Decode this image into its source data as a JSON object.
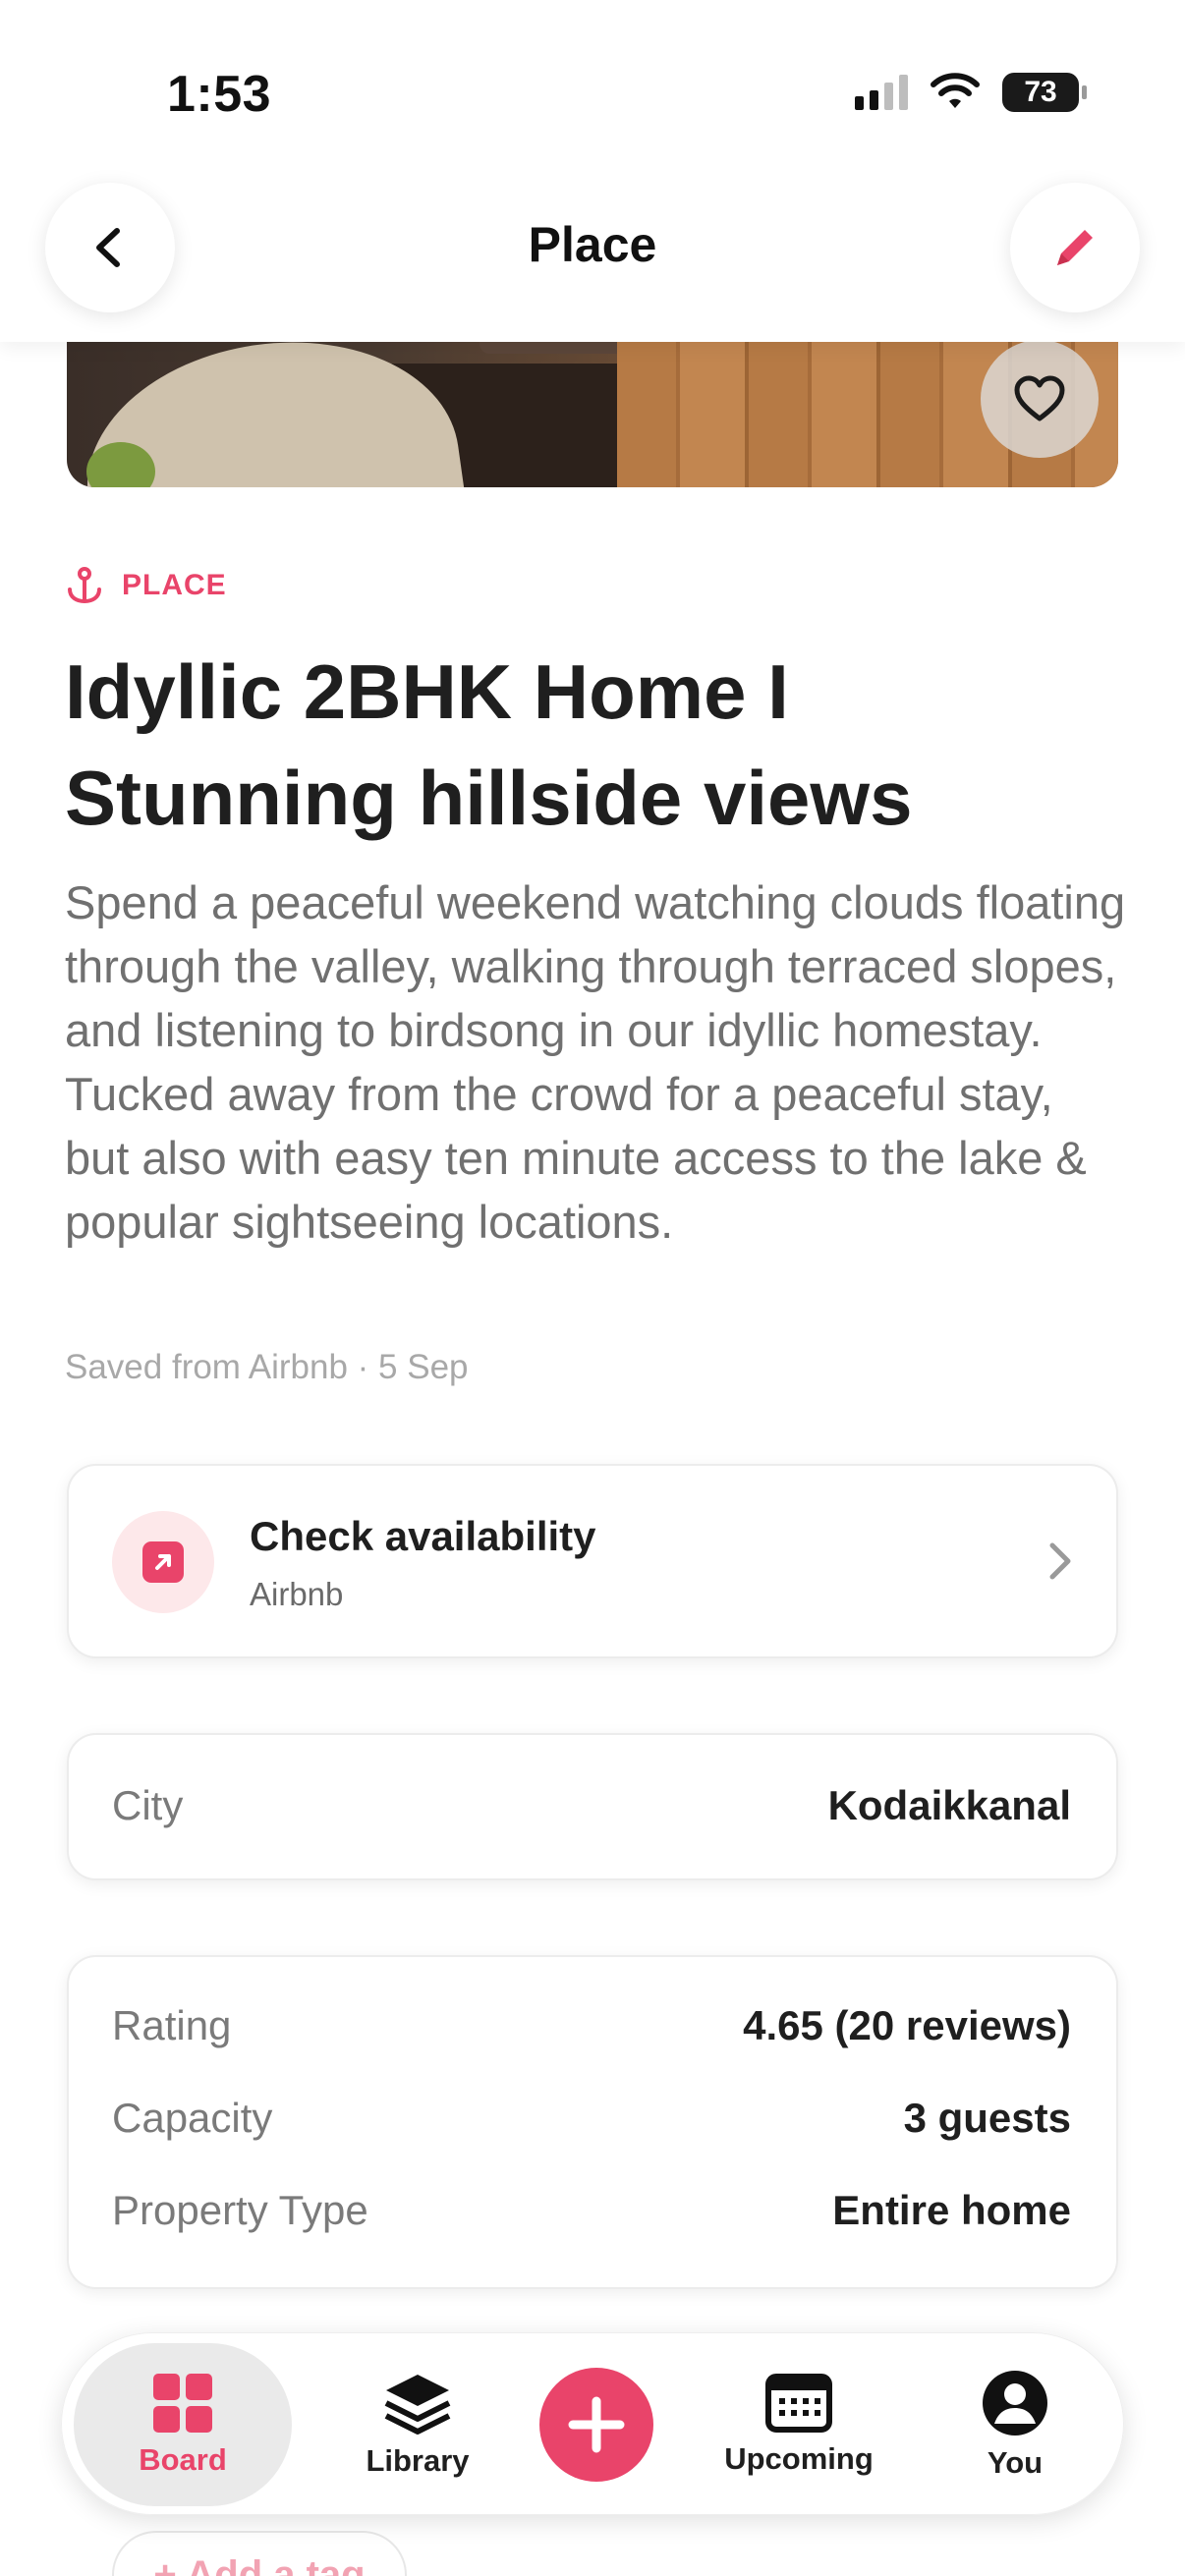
{
  "status_bar": {
    "time": "1:53",
    "battery": "73",
    "icons": [
      "signal-icon",
      "wifi-icon",
      "battery-icon"
    ]
  },
  "header": {
    "title": "Place",
    "back_icon": "chevron-left-icon",
    "edit_icon": "pencil-icon"
  },
  "hero": {
    "favorite_icon": "heart-icon"
  },
  "item": {
    "type_label": "PLACE",
    "type_icon": "anchor-pin-icon",
    "title": "Idyllic 2BHK Home I Stunning hillside views",
    "description": "Spend a peaceful weekend watching clouds floating through the valley, walking through terraced slopes, and listening to birdsong in our idyllic homestay. Tucked away from the crowd for a peaceful stay, but also with easy ten minute access to the lake & popular sightseeing locations.",
    "meta": "Saved from Airbnb · 5 Sep"
  },
  "link_card": {
    "title": "Check availability",
    "subtitle": "Airbnb",
    "icon": "external-link-icon"
  },
  "details_city": {
    "label": "City",
    "value": "Kodaikkanal"
  },
  "details": [
    {
      "label": "Rating",
      "value": "4.65 (20 reviews)"
    },
    {
      "label": "Capacity",
      "value": "3 guests"
    },
    {
      "label": "Property Type",
      "value": "Entire home"
    }
  ],
  "tags": {
    "add_label": "+ Add a tag"
  },
  "nav": {
    "items": [
      {
        "label": "Board",
        "icon": "grid-icon",
        "active": true
      },
      {
        "label": "Library",
        "icon": "layers-icon",
        "active": false
      },
      {
        "label": "",
        "icon": "plus-icon",
        "active": false
      },
      {
        "label": "Upcoming",
        "icon": "calendar-icon",
        "active": false
      },
      {
        "label": "You",
        "icon": "user-icon",
        "active": false
      }
    ]
  },
  "colors": {
    "accent": "#e9446a",
    "text": "#1f1f1f",
    "muted": "#707070"
  }
}
